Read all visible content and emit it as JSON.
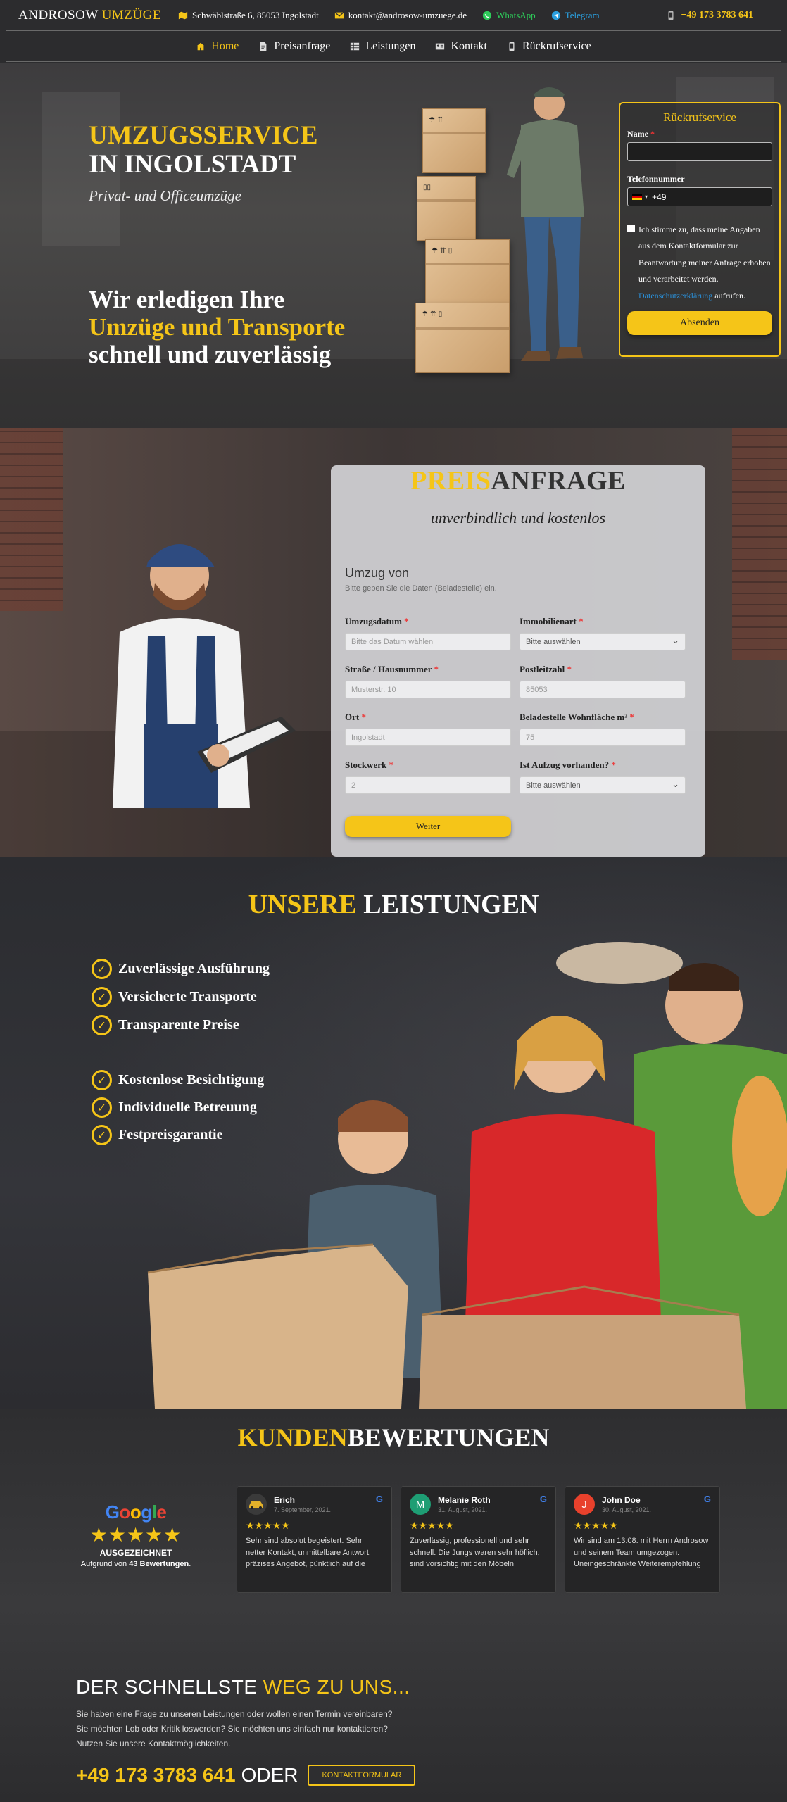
{
  "topbar": {
    "logo_main": "ANDROSOW",
    "logo_accent": "UMZÜGE",
    "address": "Schwäblstraße 6, 85053 Ingolstadt",
    "email": "kontakt@androsow-umzuege.de",
    "whatsapp": "WhatsApp",
    "telegram": "Telegram",
    "phone": "+49 173 3783 641"
  },
  "nav": {
    "items": [
      {
        "label": "Home"
      },
      {
        "label": "Preisanfrage"
      },
      {
        "label": "Leistungen"
      },
      {
        "label": "Kontakt"
      },
      {
        "label": "Rückrufservice"
      }
    ]
  },
  "hero": {
    "title_line1": "UMZUGSSERVICE",
    "title_line2": "IN INGOLSTADT",
    "subtitle": "Privat- und Officeumzüge",
    "slogan_line1": "Wir erledigen Ihre",
    "slogan_line2": "Umzüge und Transporte",
    "slogan_line3": "schnell und zuverlässig"
  },
  "callback": {
    "title": "Rückrufservice",
    "name_label": "Name",
    "phone_label": "Telefonnummer",
    "phone_prefix": "+49",
    "consent_text": "Ich stimme zu, dass meine Angaben aus dem Kontaktformular zur Beantwortung meiner Anfrage erhoben und verarbeitet werden.",
    "consent_link": "Datenschutzerklärung",
    "consent_suffix": "aufrufen.",
    "submit": "Absenden"
  },
  "preis": {
    "title_accent": "PREIS",
    "title_rest": "ANFRAGE",
    "subtitle": "unverbindlich und kostenlos",
    "section": "Umzug von",
    "hint": "Bitte geben Sie die Daten (Beladestelle) ein.",
    "fields": [
      {
        "label": "Umzugsdatum",
        "placeholder": "Bitte das Datum wählen"
      },
      {
        "label": "Immobilienart",
        "placeholder": "Bitte auswählen"
      },
      {
        "label": "Straße / Hausnummer",
        "placeholder": "Musterstr. 10"
      },
      {
        "label": "Postleitzahl",
        "placeholder": "85053"
      },
      {
        "label": "Ort",
        "placeholder": "Ingolstadt"
      },
      {
        "label": "Beladestelle Wohnfläche m²",
        "placeholder": "75"
      },
      {
        "label": "Stockwerk",
        "placeholder": "2"
      },
      {
        "label": "Ist Aufzug vorhanden?",
        "placeholder": "Bitte auswählen"
      }
    ],
    "next": "Weiter"
  },
  "leistungen": {
    "title_accent": "UNSERE",
    "title_rest": "LEISTUNGEN",
    "features": [
      "Zuverlässige Ausführung",
      "Versicherte Transporte",
      "Transparente Preise",
      "Kostenlose Besichtigung",
      "Individuelle Betreuung",
      "Festpreisgarantie"
    ]
  },
  "reviews": {
    "title_accent": "KUNDEN",
    "title_rest": "BEWERTUNGEN",
    "google_word": "Google",
    "stars": "★★★★★",
    "badge": "AUSGEZEICHNET",
    "based_on_prefix": "Aufgrund von",
    "based_on_count": "43 Bewertungen",
    "based_on_suffix": ".",
    "cards": [
      {
        "name": "Erich",
        "date": "7. September, 2021.",
        "initial": "",
        "avatar_color": "#3a3a3a",
        "stars": "★★★★★",
        "text": "Sehr sind absolut begeistert. Sehr netter Kontakt, unmittelbare Antwort, präzises Angebot, pünktlich auf die Minute und"
      },
      {
        "name": "Melanie Roth",
        "date": "31. August, 2021.",
        "initial": "M",
        "avatar_color": "#1e9e74",
        "stars": "★★★★★",
        "text": "Zuverlässig, professionell und sehr schnell. Die Jungs waren sehr höflich, sind vorsichtig mit den Möbeln umgegangen und haben"
      },
      {
        "name": "John Doe",
        "date": "30. August, 2021.",
        "initial": "J",
        "avatar_color": "#e8412c",
        "stars": "★★★★★",
        "text": "Wir sind am 13.08. mit Herrn Androsow und seinem Team umgezogen. Uneingeschränkte Weiterempfehlung für Androsow"
      }
    ]
  },
  "contact": {
    "title_main": "DER SCHNELLSTE",
    "title_accent": "WEG ZU UNS...",
    "line1": "Sie haben eine Frage zu unseren Leistungen oder wollen einen Termin vereinbaren?",
    "line2": "Sie möchten Lob oder Kritik loswerden? Sie möchten uns einfach nur kontaktieren?",
    "line3": "Nutzen Sie unsere Kontaktmöglichkeiten.",
    "phone": "+49 173 3783 641",
    "oder": "ODER",
    "button": "KONTAKTFORMULAR"
  }
}
